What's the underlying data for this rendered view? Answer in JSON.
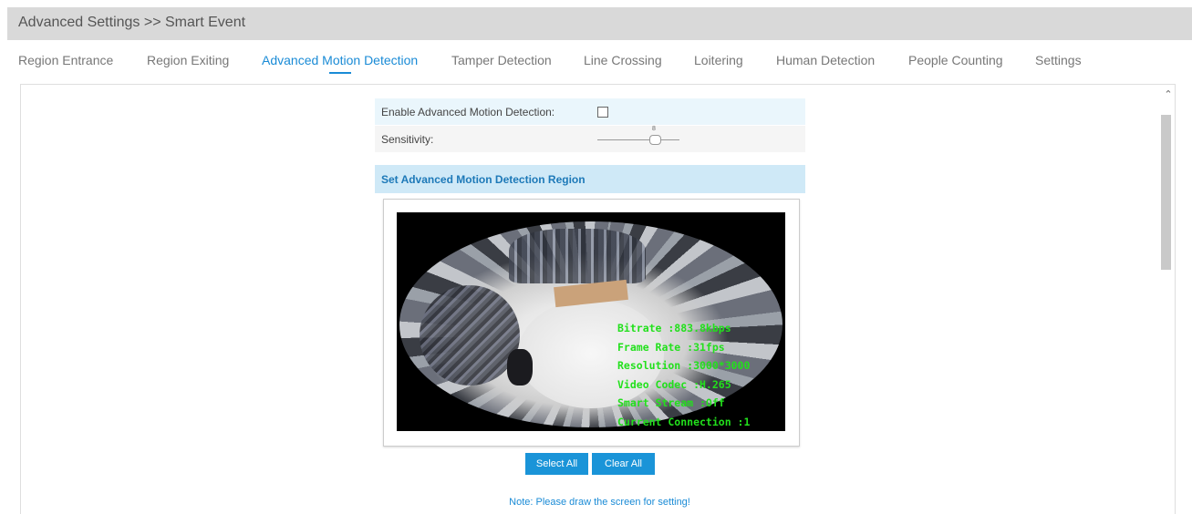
{
  "header": {
    "title": "Advanced Settings >> Smart Event"
  },
  "tabs": [
    {
      "label": "Region Entrance",
      "active": false
    },
    {
      "label": "Region Exiting",
      "active": false
    },
    {
      "label": "Advanced Motion Detection",
      "active": true
    },
    {
      "label": "Tamper Detection",
      "active": false
    },
    {
      "label": "Line Crossing",
      "active": false
    },
    {
      "label": "Loitering",
      "active": false
    },
    {
      "label": "Human Detection",
      "active": false
    },
    {
      "label": "People Counting",
      "active": false
    },
    {
      "label": "Settings",
      "active": false
    }
  ],
  "form": {
    "enable_label": "Enable Advanced Motion Detection:",
    "enable_checked": false,
    "sensitivity_label": "Sensitivity:",
    "sensitivity_value": "8",
    "sensitivity_level": 0.7
  },
  "region": {
    "header": "Set Advanced Motion Detection Region",
    "osd": [
      "Bitrate :883.8kbps",
      "Frame Rate :31fps",
      "Resolution :3000*3000",
      "Video Codec :H.265",
      "Smart Stream :Off",
      "Current Connection :1"
    ]
  },
  "buttons": {
    "select_all": "Select All",
    "clear_all": "Clear All"
  },
  "note": "Note: Please draw the screen for setting!",
  "colors": {
    "accent": "#1a8bd6",
    "button": "#1a94d8",
    "osd_text": "#22e01c",
    "header_bg": "#d9d9d9"
  }
}
